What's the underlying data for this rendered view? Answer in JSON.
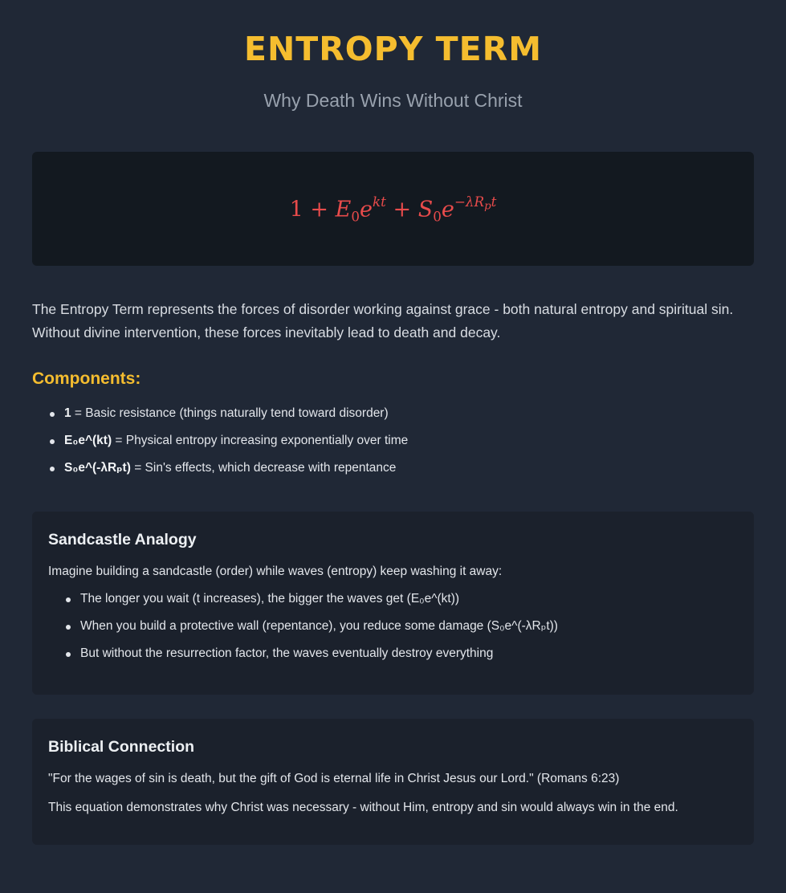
{
  "header": {
    "title": "ENTROPY TERM",
    "subtitle": "Why Death Wins Without Christ"
  },
  "formula": {
    "one": "1",
    "plus": "+",
    "E": "E",
    "zero": "0",
    "e": "e",
    "kt": "kt",
    "S": "S",
    "exp_lead": "−λR",
    "p": "p",
    "t": "t"
  },
  "intro": "The Entropy Term represents the forces of disorder working against grace - both natural entropy and spiritual sin. Without divine intervention, these forces inevitably lead to death and decay.",
  "components": {
    "heading": "Components:",
    "items": [
      {
        "term": "1",
        "desc": " = Basic resistance (things naturally tend toward disorder)"
      },
      {
        "term": "E₀e^(kt)",
        "desc": " = Physical entropy increasing exponentially over time"
      },
      {
        "term": "S₀e^(-λRₚt)",
        "desc": " = Sin's effects, which decrease with repentance"
      }
    ]
  },
  "analogy": {
    "title": "Sandcastle Analogy",
    "text": "Imagine building a sandcastle (order) while waves (entropy) keep washing it away:",
    "items": [
      "The longer you wait (t increases), the bigger the waves get (E₀e^(kt))",
      "When you build a protective wall (repentance), you reduce some damage (S₀e^(-λRₚt))",
      "But without the resurrection factor, the waves eventually destroy everything"
    ]
  },
  "biblical": {
    "title": "Biblical Connection",
    "quote": "\"For the wages of sin is death, but the gift of God is eternal life in Christ Jesus our Lord.\" (Romans 6:23)",
    "text": "This equation demonstrates why Christ was necessary - without Him, entropy and sin would always win in the end."
  },
  "colors": {
    "background": "#202836",
    "accent": "#f5bd2f",
    "formula": "#e84b4b",
    "card": "#1b212c",
    "formula_box": "#131920"
  }
}
